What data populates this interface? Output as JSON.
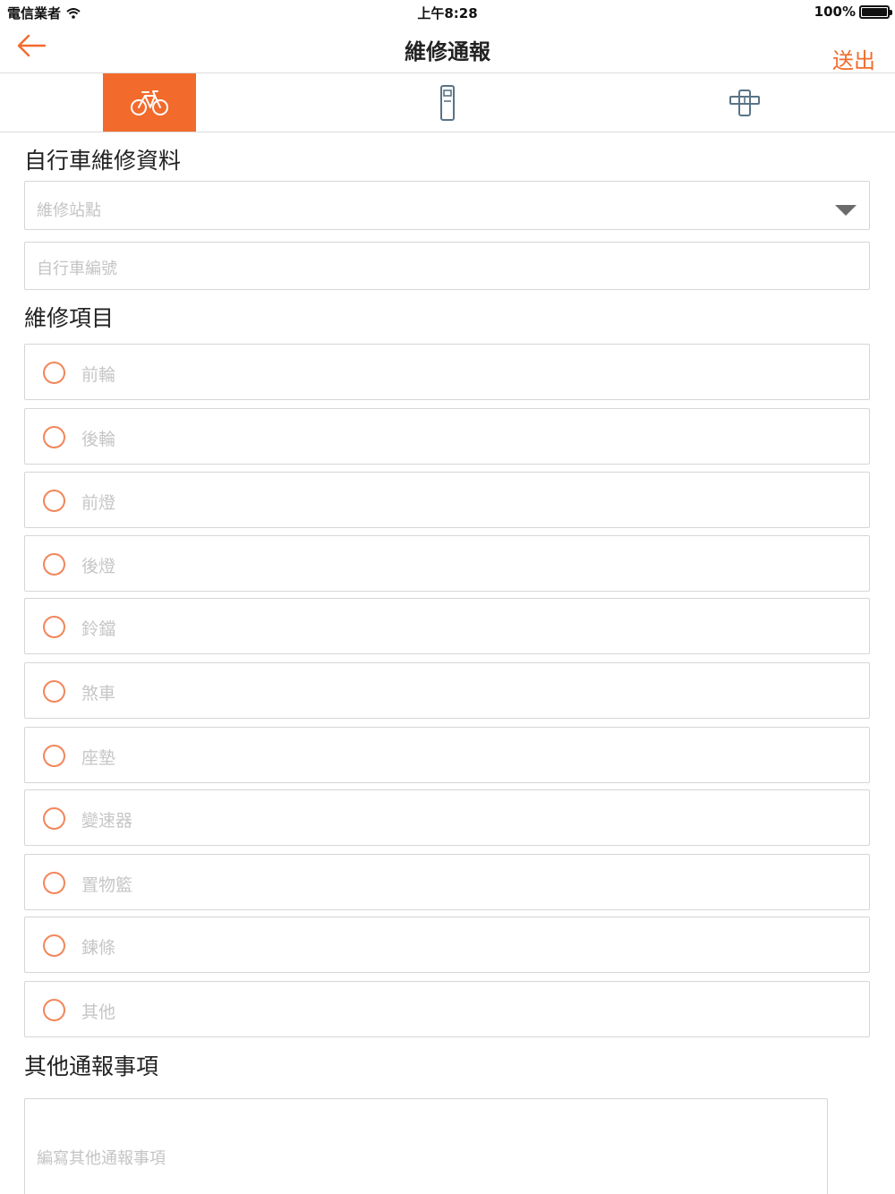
{
  "status_bar": {
    "carrier": "電信業者",
    "time": "上午8:28",
    "battery": "100%"
  },
  "nav": {
    "title": "維修通報",
    "submit_label": "送出"
  },
  "tabs": [
    {
      "icon": "bicycle-icon",
      "active": true
    },
    {
      "icon": "kiosk-icon",
      "active": false
    },
    {
      "icon": "dock-icon",
      "active": false
    }
  ],
  "bike_section": {
    "title": "自行車維修資料",
    "station_placeholder": "維修站點",
    "bike_number_placeholder": "自行車編號"
  },
  "repair_section": {
    "title": "維修項目",
    "items": [
      "前輪",
      "後輪",
      "前燈",
      "後燈",
      "鈴鐺",
      "煞車",
      "座墊",
      "變速器",
      "置物籃",
      "鍊條",
      "其他"
    ]
  },
  "other_section": {
    "title": "其他通報事項",
    "placeholder": "編寫其他通報事項"
  },
  "colors": {
    "accent": "#f26b2c",
    "placeholder": "#c4c4c4",
    "border": "#d6d6d6"
  }
}
